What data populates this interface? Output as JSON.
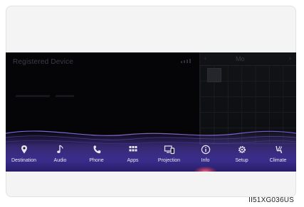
{
  "screen": {
    "title": "Registered Device",
    "panel_month": "Mo"
  },
  "nav": {
    "items": [
      {
        "label": "Destination",
        "icon": "destination-pin-icon",
        "active": false
      },
      {
        "label": "Audio",
        "icon": "music-note-icon",
        "active": false
      },
      {
        "label": "Phone",
        "icon": "phone-icon",
        "active": false
      },
      {
        "label": "Apps",
        "icon": "apps-grid-icon",
        "active": false
      },
      {
        "label": "Projection",
        "icon": "projection-icon",
        "active": false
      },
      {
        "label": "Info",
        "icon": "info-icon",
        "active": true
      },
      {
        "label": "Setup",
        "icon": "gear-icon",
        "active": false
      },
      {
        "label": "Climate",
        "icon": "climate-seat-icon",
        "active": false
      }
    ]
  },
  "caption": "II51XG036US",
  "colors": {
    "screen_bg": "#050508",
    "accent_active": "#e0506f",
    "wave": "#6a4bd8"
  }
}
